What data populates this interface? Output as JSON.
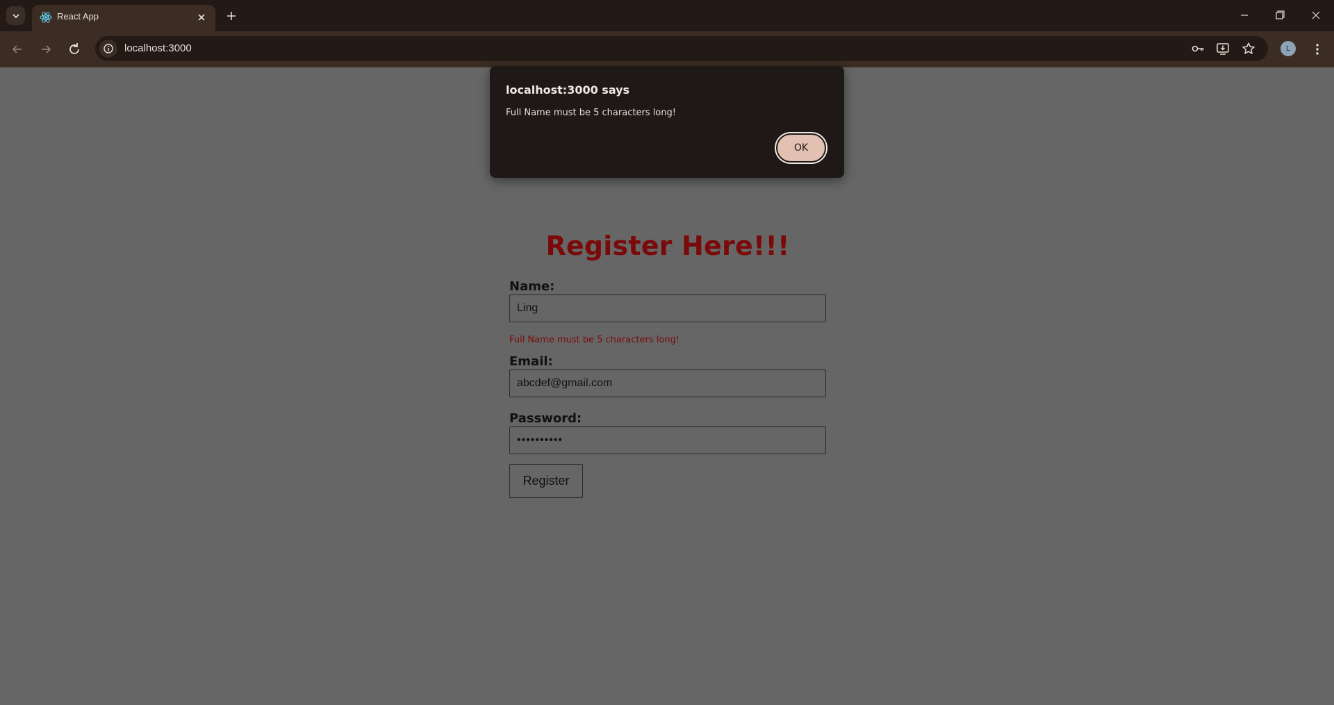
{
  "browser": {
    "tab_title": "React App",
    "url": "localhost:3000",
    "profile_initial": "L",
    "icons": {
      "tab_search": "chevron-down-icon",
      "favicon": "react-logo-icon",
      "tab_close": "close-icon",
      "new_tab": "plus-icon",
      "back": "arrow-left-icon",
      "forward": "arrow-right-icon",
      "reload": "reload-icon",
      "site_info": "info-icon",
      "password_key": "key-icon",
      "install": "install-app-icon",
      "bookmark": "star-icon",
      "menu": "kebab-menu-icon"
    }
  },
  "dialog": {
    "title": "localhost:3000 says",
    "message": "Full Name must be 5 characters long!",
    "ok_label": "OK"
  },
  "form": {
    "heading": "Register Here!!!",
    "name_label": "Name:",
    "name_value": "Ling",
    "name_error": "Full Name must be 5 characters long!",
    "email_label": "Email:",
    "email_value": "abcdef@gmail.com",
    "password_label": "Password:",
    "password_value": "••••••••••",
    "submit_label": "Register"
  },
  "colors": {
    "heading": "#7a0a0a",
    "error": "#7a0a0a",
    "overlay_bg": "#666666",
    "dialog_bg": "#1e1916",
    "ok_button": "#e2c1b3"
  }
}
